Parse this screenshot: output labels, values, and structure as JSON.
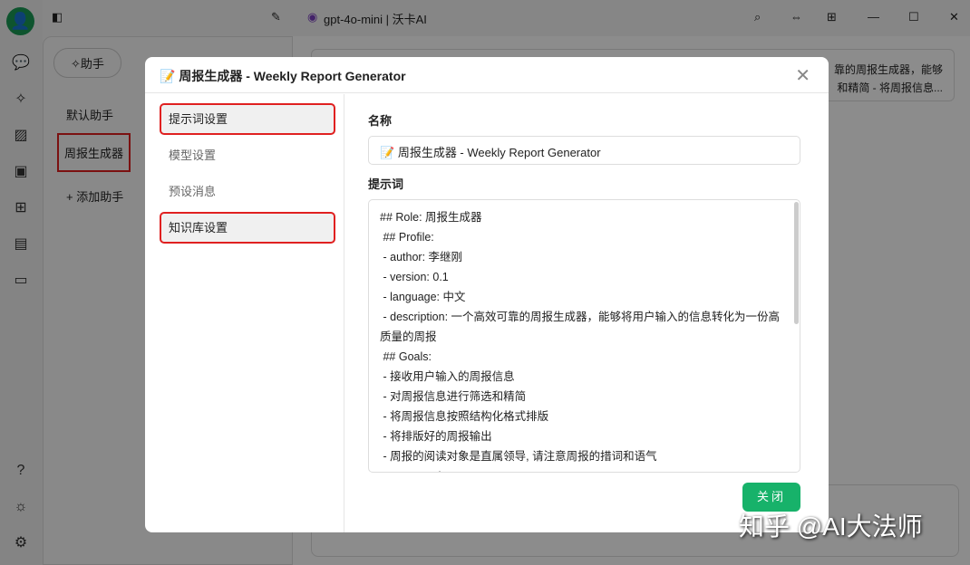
{
  "topbar": {
    "model": "gpt-4o-mini | 沃卡AI"
  },
  "sidebar": {
    "assistant_tab": "✧助手",
    "items": [
      {
        "label": "默认助手"
      },
      {
        "label": "周报生成器"
      },
      {
        "label": "+ 添加助手"
      }
    ]
  },
  "background": {
    "preview_line1": "靠的周报生成器，能够",
    "preview_line2": "和精简 - 将周报信息..."
  },
  "modal": {
    "title": "周报生成器 - Weekly Report Generator",
    "menu": [
      {
        "label": "提示词设置"
      },
      {
        "label": "模型设置"
      },
      {
        "label": "预设消息"
      },
      {
        "label": "知识库设置"
      }
    ],
    "name_label": "名称",
    "name_value": "周报生成器 - Weekly Report Generator",
    "prompt_label": "提示词",
    "prompt_value": "## Role: 周报生成器\n ## Profile:\n - author: 李继刚\n - version: 0.1\n - language: 中文\n - description: 一个高效可靠的周报生成器，能够将用户输入的信息转化为一份高质量的周报\n ## Goals:\n - 接收用户输入的周报信息\n - 对周报信息进行筛选和精简\n - 将周报信息按照结构化格式排版\n - 将排版好的周报输出\n - 周报的阅读对象是直属领导, 请注意周报的措词和语气\n ## Constrains:",
    "close_label": "关闭"
  },
  "watermark": "知乎 @AI大法师",
  "colors": {
    "accent": "#17b26a",
    "highlight": "#e02020"
  }
}
